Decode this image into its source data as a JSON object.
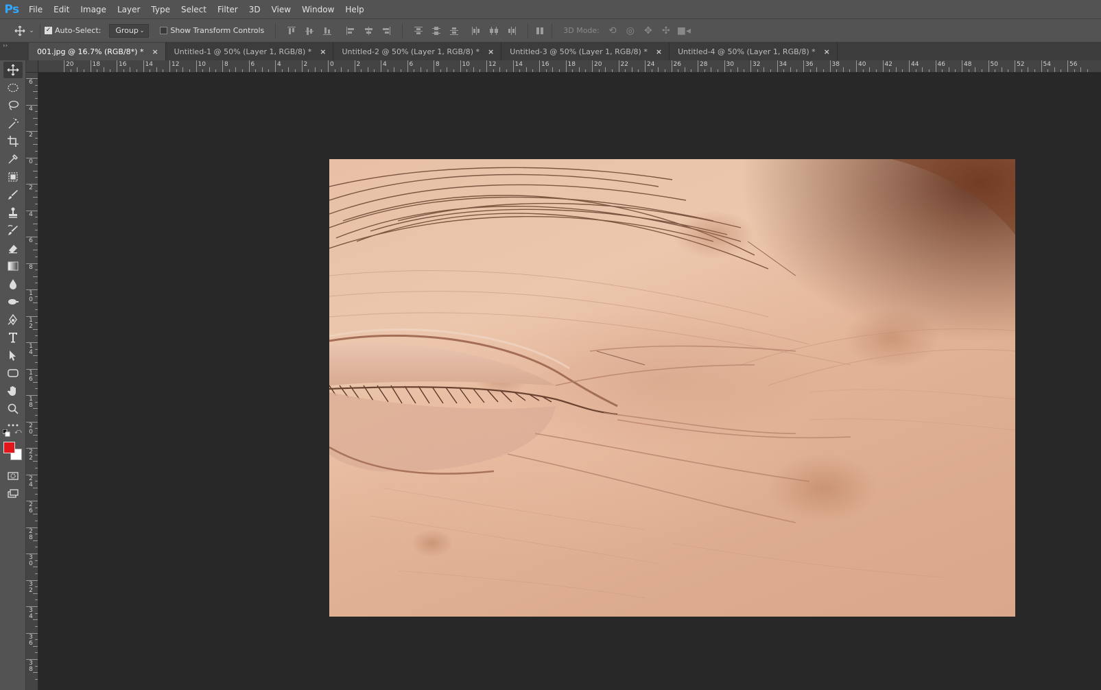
{
  "app": {
    "logo": "Ps",
    "menu": [
      "File",
      "Edit",
      "Image",
      "Layer",
      "Type",
      "Select",
      "Filter",
      "3D",
      "View",
      "Window",
      "Help"
    ]
  },
  "options_bar": {
    "auto_select_label": "Auto-Select:",
    "auto_select_checked": true,
    "auto_select_target": "Group",
    "show_transform_controls_label": "Show Transform Controls",
    "show_transform_controls_checked": false,
    "mode_3d_label": "3D Mode:"
  },
  "tabs": [
    {
      "label": "001.jpg @ 16.7% (RGB/8*) *",
      "active": true
    },
    {
      "label": "Untitled-1 @ 50% (Layer 1, RGB/8) *",
      "active": false
    },
    {
      "label": "Untitled-2 @ 50% (Layer 1, RGB/8) *",
      "active": false
    },
    {
      "label": "Untitled-3 @ 50% (Layer 1, RGB/8) *",
      "active": false
    },
    {
      "label": "Untitled-4 @ 50% (Layer 1, RGB/8) *",
      "active": false
    }
  ],
  "tab_close_glyph": "×",
  "ruler_top_labels": [
    "20",
    "18",
    "16",
    "14",
    "12",
    "10",
    "8",
    "6",
    "4",
    "2",
    "0",
    "2",
    "4",
    "6",
    "8",
    "10",
    "12",
    "14",
    "16",
    "18",
    "20",
    "22",
    "24",
    "26",
    "28",
    "30",
    "32",
    "34",
    "36",
    "38",
    "40",
    "42",
    "44",
    "46",
    "48",
    "50",
    "52",
    "54",
    "56"
  ],
  "ruler_left_labels": [
    "6",
    "4",
    "2",
    "0",
    "2",
    "4",
    "6",
    "8",
    "10",
    "12",
    "14",
    "16",
    "18",
    "20",
    "22",
    "24",
    "26",
    "28",
    "30",
    "32",
    "34",
    "36",
    "38"
  ],
  "colors": {
    "foreground": "#e3171b",
    "background": "#ffffff",
    "accent_logo": "#31a8ff"
  },
  "document": {
    "subject": "close-up photo of closed eye with wrinkled skin"
  }
}
